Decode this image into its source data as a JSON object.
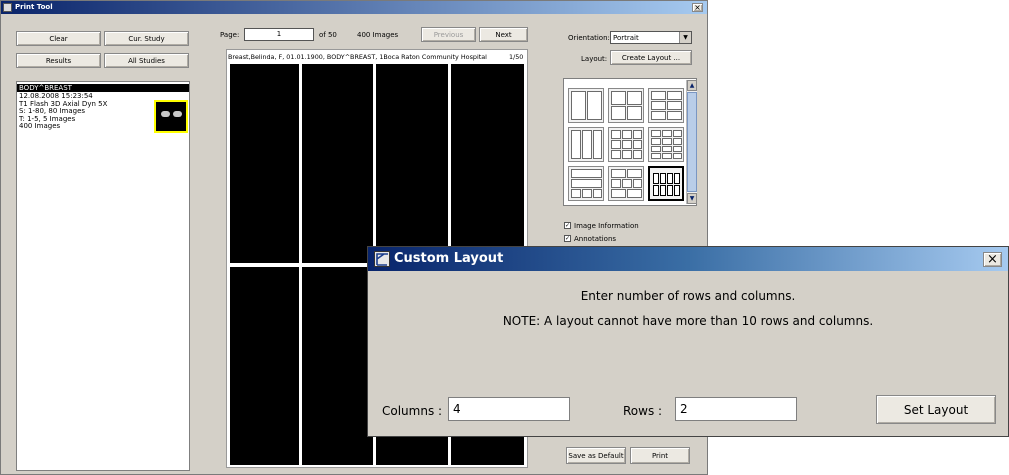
{
  "window": {
    "title": "Print Tool",
    "close_glyph": "×"
  },
  "left": {
    "buttons": {
      "clear": "Clear",
      "cur_study": "Cur. Study",
      "results": "Results",
      "all_studies": "All Studies"
    },
    "study": {
      "header": "BODY^BREAST",
      "lines": [
        "12.08.2008 15:23:54",
        "T1 Flash 3D Axial Dyn 5X",
        "S: 1-80, 80 Images",
        "T: 1-5, 5 Images",
        "400 Images"
      ]
    }
  },
  "center": {
    "page_label": "Page:",
    "page_value": "1",
    "of_label": "of  50",
    "images_label": "400 Images",
    "previous": "Previous",
    "next": "Next",
    "info_line": "Breast,Belinda, F, 01.01.1900, BODY^BREAST, 1Boca Raton Community Hospital",
    "page_ratio": "1/50"
  },
  "right": {
    "orientation_label": "Orientation:",
    "orientation_value": "Portrait",
    "layout_label": "Layout:",
    "create_layout": "Create Layout ...",
    "image_information": "Image Information",
    "annotations": "Annotations",
    "save_default": "Save as Default",
    "print": "Print"
  },
  "dialog": {
    "title": "Custom Layout",
    "close_glyph": "×",
    "line1": "Enter number of rows and columns.",
    "line2": "NOTE: A layout cannot have more than 10 rows and columns.",
    "columns_label": "Columns :",
    "columns_value": "4",
    "rows_label": "Rows :",
    "rows_value": "2",
    "set_layout": "Set Layout"
  },
  "colors": {
    "title_blue": "#0a246a",
    "selected_thumb": "#ffff00",
    "panel_bg": "#d4d0c8"
  },
  "icons": [
    "app-icon",
    "close-icon",
    "checkbox-checked-icon",
    "dropdown-arrow-icon",
    "scroll-up-arrow-icon",
    "scroll-down-arrow-icon",
    "custom-layout-icon"
  ]
}
